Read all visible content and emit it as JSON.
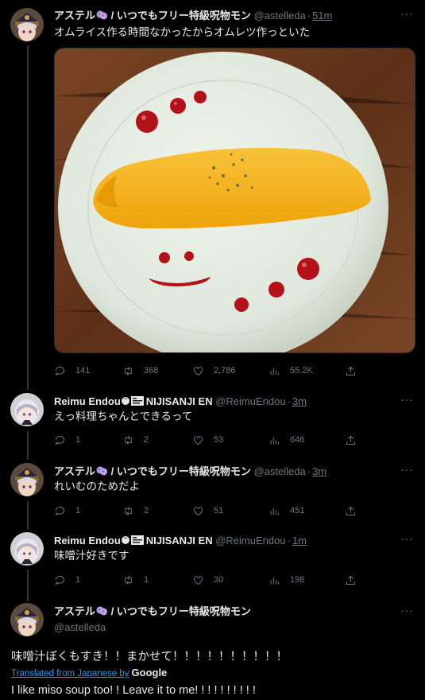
{
  "tweets": [
    {
      "name": "アステル",
      "name_suffix": " / いつでもフリー特級呪物モン",
      "handle": "@astelleda",
      "time": "51m",
      "text": "オムライス作る時間なかったからオムレツ作っといた",
      "stats": {
        "replies": "141",
        "retweets": "368",
        "likes": "2,786",
        "views": "55.2K"
      }
    },
    {
      "name": "Reimu Endou",
      "name_suffix": "NIJISANJI EN",
      "handle": "@ReimuEndou",
      "time": "3m",
      "text": "えっ料理ちゃんとできるって",
      "stats": {
        "replies": "1",
        "retweets": "2",
        "likes": "53",
        "views": "646"
      }
    },
    {
      "name": "アステル",
      "name_suffix": " / いつでもフリー特級呪物モン",
      "handle": "@astelleda",
      "time": "3m",
      "text": "れいむのためだよ",
      "stats": {
        "replies": "1",
        "retweets": "2",
        "likes": "51",
        "views": "451"
      }
    },
    {
      "name": "Reimu Endou",
      "name_suffix": "NIJISANJI EN",
      "handle": "@ReimuEndou",
      "time": "1m",
      "text": "味噌汁好きです",
      "stats": {
        "replies": "1",
        "retweets": "1",
        "likes": "30",
        "views": "198"
      }
    }
  ],
  "main_tweet": {
    "name": "アステル",
    "name_suffix": " / いつでもフリー特級呪物モン",
    "handle": "@astelleda",
    "text": "味噌汁ぼくもすき！！まかせて！！！！！！！！！！",
    "translated_label": "Translated from Japanese by",
    "translator": "Google",
    "translation": "I like miso soup too! ! Leave it to me! ! ! ! ! ! ! ! ! !"
  },
  "icons": {
    "more": "more-icon",
    "reply": "reply-icon",
    "retweet": "retweet-icon",
    "like": "heart-icon",
    "views": "views-icon",
    "share": "share-icon"
  },
  "colors": {
    "background": "#000000",
    "text": "#e7e9ea",
    "muted": "#71767b",
    "link": "#1d9bf0",
    "plate": "#dfe8dc",
    "omelet": "#f5b417",
    "ketchup": "#b3121a",
    "wood": "#6b3a1c"
  }
}
